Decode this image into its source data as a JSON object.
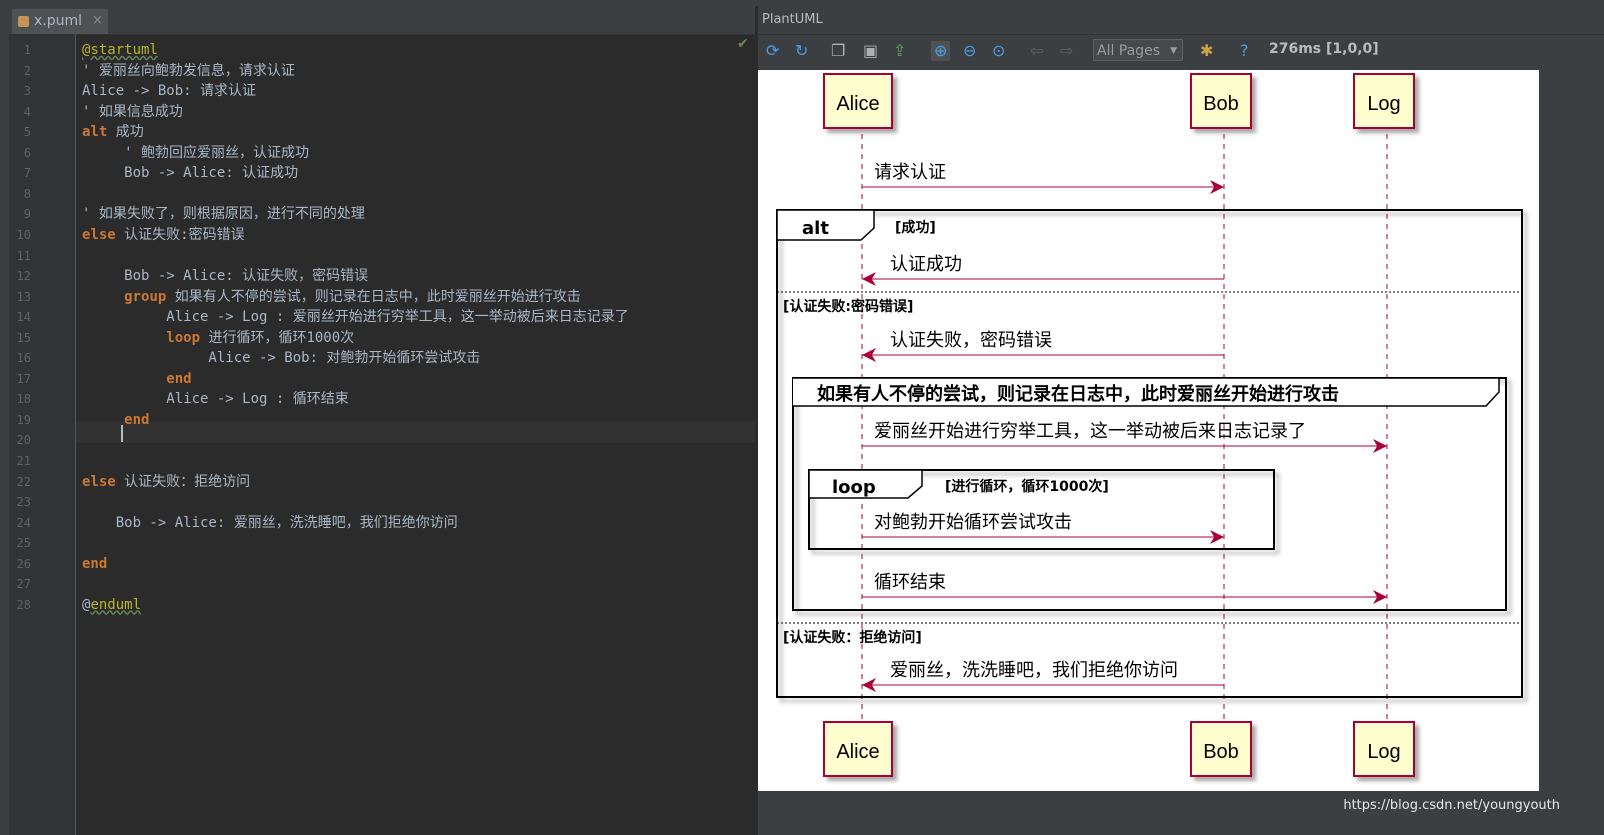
{
  "editor": {
    "tab": {
      "filename": "x.puml",
      "close": "×"
    },
    "lines": [
      {
        "n": "1",
        "parts": [
          {
            "t": "@startuml",
            "c": "dir"
          }
        ]
      },
      {
        "n": "2",
        "parts": [
          {
            "t": "' 爱丽丝向鲍勃发信息，请求认证"
          }
        ]
      },
      {
        "n": "3",
        "parts": [
          {
            "t": "Alice -> Bob: 请求认证"
          }
        ]
      },
      {
        "n": "4",
        "parts": [
          {
            "t": "' 如果信息成功"
          }
        ]
      },
      {
        "n": "5",
        "parts": [
          {
            "t": "alt",
            "c": "kw"
          },
          {
            "t": " 成功"
          }
        ]
      },
      {
        "n": "6",
        "parts": [
          {
            "t": "     ' 鲍勃回应爱丽丝，认证成功"
          }
        ]
      },
      {
        "n": "7",
        "parts": [
          {
            "t": "     Bob -> Alice: 认证成功"
          }
        ]
      },
      {
        "n": "8",
        "parts": []
      },
      {
        "n": "9",
        "parts": [
          {
            "t": "' 如果失败了，则根据原因，进行不同的处理"
          }
        ]
      },
      {
        "n": "10",
        "parts": [
          {
            "t": "else",
            "c": "kw"
          },
          {
            "t": " 认证失败:密码错误"
          }
        ]
      },
      {
        "n": "11",
        "parts": []
      },
      {
        "n": "12",
        "parts": [
          {
            "t": "     Bob -> Alice: 认证失败，密码错误"
          }
        ]
      },
      {
        "n": "13",
        "parts": [
          {
            "t": "     "
          },
          {
            "t": "group",
            "c": "kw"
          },
          {
            "t": " 如果有人不停的尝试，则记录在日志中，此时爱丽丝开始进行攻击"
          }
        ]
      },
      {
        "n": "14",
        "parts": [
          {
            "t": "          Alice -> Log : 爱丽丝开始进行穷举工具，这一举动被后来日志记录了"
          }
        ]
      },
      {
        "n": "15",
        "parts": [
          {
            "t": "          "
          },
          {
            "t": "loop",
            "c": "kw"
          },
          {
            "t": " 进行循环，循环1000次"
          }
        ]
      },
      {
        "n": "16",
        "parts": [
          {
            "t": "               Alice -> Bob: 对鲍勃开始循环尝试攻击"
          }
        ]
      },
      {
        "n": "17",
        "parts": [
          {
            "t": "          "
          },
          {
            "t": "end",
            "c": "kw"
          }
        ]
      },
      {
        "n": "18",
        "parts": [
          {
            "t": "          Alice -> Log : 循环结束"
          }
        ]
      },
      {
        "n": "19",
        "parts": [
          {
            "t": "     "
          },
          {
            "t": "end",
            "c": "kw"
          }
        ]
      },
      {
        "n": "20",
        "parts": []
      },
      {
        "n": "21",
        "parts": []
      },
      {
        "n": "22",
        "parts": [
          {
            "t": "else",
            "c": "kw"
          },
          {
            "t": " 认证失败：拒绝访问"
          }
        ]
      },
      {
        "n": "23",
        "parts": []
      },
      {
        "n": "24",
        "parts": [
          {
            "t": "    Bob -> Alice: 爱丽丝，洗洗睡吧，我们拒绝你访问"
          }
        ]
      },
      {
        "n": "25",
        "parts": []
      },
      {
        "n": "26",
        "parts": [
          {
            "t": "end",
            "c": "kw"
          }
        ]
      },
      {
        "n": "27",
        "parts": []
      },
      {
        "n": "28",
        "parts": [
          {
            "t": "@"
          },
          {
            "t": "enduml",
            "c": "dir"
          }
        ]
      }
    ]
  },
  "plantuml": {
    "panel_title": "PlantUML",
    "toolbar": {
      "icons": [
        "refresh-icon",
        "auto-refresh-icon",
        "copy-icon",
        "save-icon",
        "export-icon",
        "zoom-actual-icon",
        "zoom-out-icon",
        "zoom-fit-icon",
        "prev-page-icon",
        "next-page-icon",
        "settings-icon",
        "help-icon"
      ],
      "pages_label": "All Pages",
      "help": "?",
      "timing": "276ms [1,0,0]"
    },
    "diagram": {
      "participants": [
        "Alice",
        "Bob",
        "Log"
      ],
      "messages": [
        {
          "from": "Alice",
          "to": "Bob",
          "label": "请求认证"
        },
        {
          "from": "Bob",
          "to": "Alice",
          "label": "认证成功"
        },
        {
          "from": "Bob",
          "to": "Alice",
          "label": "认证失败，密码错误"
        },
        {
          "from": "Alice",
          "to": "Log",
          "label": "爱丽丝开始进行穷举工具，这一举动被后来日志记录了"
        },
        {
          "from": "Alice",
          "to": "Bob",
          "label": "对鲍勃开始循环尝试攻击"
        },
        {
          "from": "Alice",
          "to": "Log",
          "label": "循环结束"
        },
        {
          "from": "Bob",
          "to": "Alice",
          "label": "爱丽丝，洗洗睡吧，我们拒绝你访问"
        }
      ],
      "alt": {
        "keyword": "alt",
        "condition": "[成功]",
        "else1": "[认证失败:密码错误]",
        "else2": "[认证失败：拒绝访问]"
      },
      "group": {
        "title": "如果有人不停的尝试，则记录在日志中，此时爱丽丝开始进行攻击"
      },
      "loop": {
        "keyword": "loop",
        "condition": "[进行循环，循环1000次]"
      }
    },
    "watermark": "https://blog.csdn.net/youngyouth"
  }
}
